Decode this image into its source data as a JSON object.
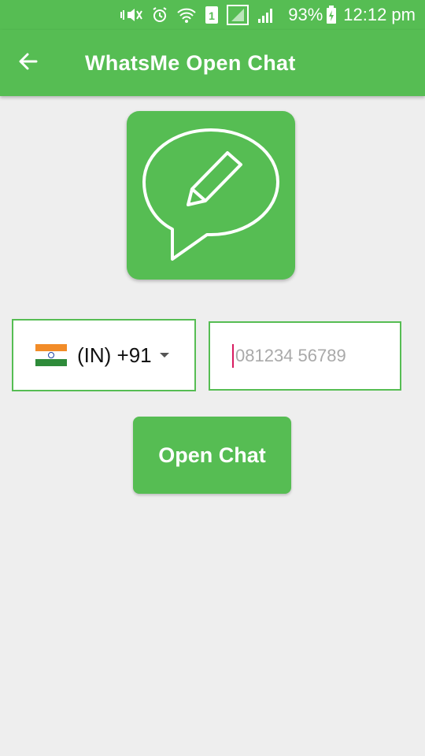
{
  "status_bar": {
    "battery_percent": "93%",
    "time": "12:12 pm",
    "icons": [
      "vibrate-mute-icon",
      "alarm-icon",
      "wifi-icon",
      "sim1-icon",
      "signal-icon",
      "signal-icon-2",
      "battery-charging-icon"
    ]
  },
  "app_bar": {
    "back_icon": "arrow-left-icon",
    "title": "WhatsMe Open Chat"
  },
  "logo": {
    "icon": "chat-bubble-pencil-icon"
  },
  "country_picker": {
    "flag": "india-flag-icon",
    "code_label": "(IN) +91"
  },
  "phone_input": {
    "placeholder": "081234 56789",
    "value": ""
  },
  "open_button": {
    "label": "Open Chat"
  },
  "colors": {
    "primary": "#56bd53",
    "background": "#eeeeee",
    "cursor": "#d81b60"
  }
}
